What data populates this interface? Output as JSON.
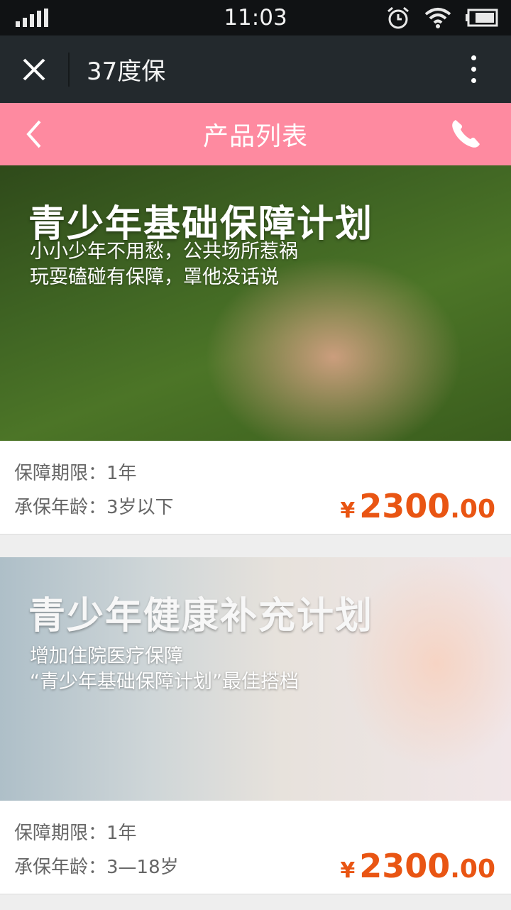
{
  "status_bar": {
    "time": "11:03"
  },
  "title_bar": {
    "title": "37度保"
  },
  "header": {
    "title": "产品列表"
  },
  "products": [
    {
      "banner_title": "青少年基础保障计划",
      "banner_sub": [
        "小小少年不用愁，公共场所惹祸",
        "玩耍磕碰有保障，罩他没话说"
      ],
      "period_label": "保障期限：",
      "period": "1年",
      "age_label": "承保年龄：",
      "age": "3岁以下",
      "currency": "¥",
      "price_int": "2300",
      "price_dec": ".00"
    },
    {
      "banner_title": "青少年健康补充计划",
      "banner_sub": [
        "增加住院医疗保障",
        "“青少年基础保障计划”最佳搭档"
      ],
      "period_label": "保障期限：",
      "period": "1年",
      "age_label": "承保年龄：",
      "age": "3—18岁",
      "currency": "¥",
      "price_int": "2300",
      "price_dec": ".00"
    }
  ],
  "colors": {
    "header": "#fe8aa0",
    "price": "#e95513",
    "titlebar": "#23292d"
  }
}
